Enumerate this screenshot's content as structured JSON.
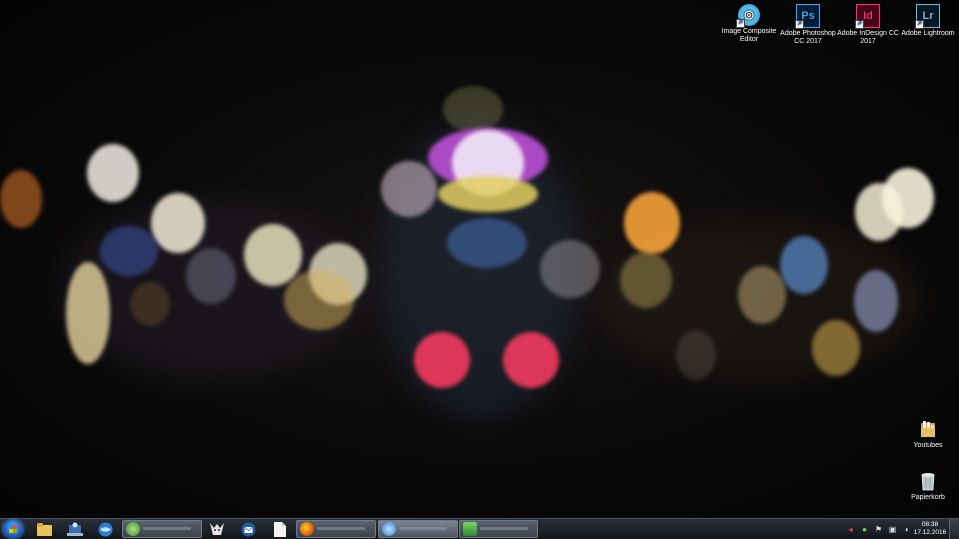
{
  "desktop": {
    "top_icons": [
      {
        "name": "image-composite-editor-icon",
        "label": "Image Composite Editor",
        "glyph": "◎",
        "color": "#3bb7e8"
      },
      {
        "name": "photoshop-icon",
        "label": "Adobe Photoshop CC 2017",
        "glyph": "Ps",
        "color": "#31a8ff"
      },
      {
        "name": "indesign-icon",
        "label": "Adobe InDesign CC 2017",
        "glyph": "Id",
        "color": "#ff3366"
      },
      {
        "name": "lightroom-icon",
        "label": "Adobe Lightroom",
        "glyph": "Lr",
        "color": "#6fb6e6"
      }
    ],
    "right_icons": [
      {
        "name": "folder-icon",
        "label": "Youtubes"
      },
      {
        "name": "recycle-bin-icon",
        "label": "Papierkorb"
      }
    ]
  },
  "taskbar": {
    "pinned": [
      {
        "name": "explorer-icon",
        "glyph": "📁"
      },
      {
        "name": "network-app-icon",
        "glyph": "🖧"
      },
      {
        "name": "browser-icon",
        "glyph": "🌐"
      },
      {
        "name": "media-app-icon",
        "glyph": "⛛"
      },
      {
        "name": "thunderbird-icon",
        "glyph": "✉"
      },
      {
        "name": "document-icon",
        "glyph": "🗎"
      }
    ],
    "clock": {
      "time": "08:38",
      "date": "17.12.2016"
    },
    "colors": {
      "accent": "#1c64c8"
    }
  }
}
